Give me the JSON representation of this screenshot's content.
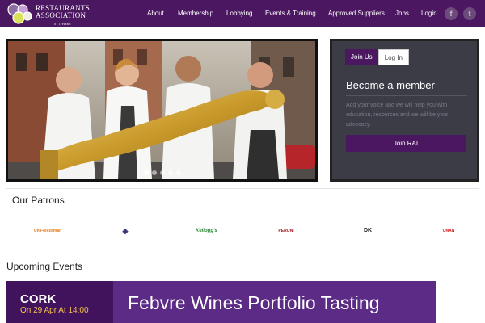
{
  "header": {
    "logo": {
      "line1": "Restaurants",
      "line2": "Association",
      "line3": "of Ireland"
    },
    "nav": [
      {
        "label": "About"
      },
      {
        "label": "Membership"
      },
      {
        "label": "Lobbying"
      },
      {
        "label": "Events & Training"
      },
      {
        "label": "Approved Suppliers"
      },
      {
        "label": "Jobs"
      },
      {
        "label": "Login"
      }
    ],
    "social": [
      {
        "icon": "facebook-icon",
        "glyph": "f"
      },
      {
        "icon": "twitter-icon",
        "glyph": "t"
      }
    ],
    "colors": {
      "brand": "#4b1760",
      "accent_gold": "#f4c34a"
    }
  },
  "hero": {
    "slide_count": 5,
    "active_slide": 1
  },
  "member_panel": {
    "tabs": [
      {
        "label": "Join Us",
        "active": true
      },
      {
        "label": "Log In",
        "active": false
      }
    ],
    "title": "Become a member",
    "description": "Add your voice and we will help you with education, resources and we will be your advocacy.",
    "join_button": "Join RAI"
  },
  "patrons": {
    "title": "Our Patrons",
    "logos": [
      {
        "name": "UniFreezeman",
        "color": "#e07a1f"
      },
      {
        "name": "◆",
        "color": "#3a3a7a"
      },
      {
        "name": "Kellogg's",
        "color": "#2a8a3a"
      },
      {
        "name": "PERONI",
        "color": "#a0161b"
      },
      {
        "name": "DK",
        "color": "#222222"
      },
      {
        "name": "ONAN",
        "color": "#d4161b"
      }
    ]
  },
  "events": {
    "title": "Upcoming Events",
    "banner": {
      "city": "CORK",
      "date": "On 29 Apr At 14:00",
      "name": "Febvre Wines Portfolio Tasting"
    }
  }
}
